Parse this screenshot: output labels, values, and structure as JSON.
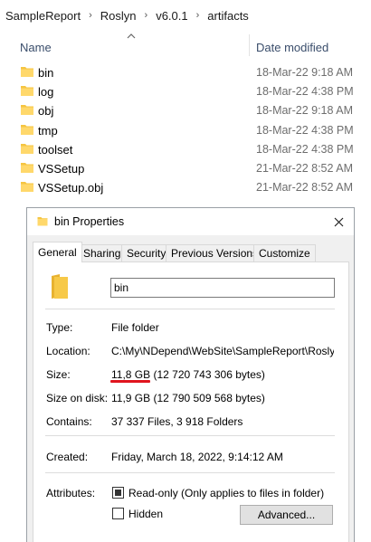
{
  "breadcrumb": [
    "SampleReport",
    "Roslyn",
    "v6.0.1",
    "artifacts"
  ],
  "columns": {
    "name": "Name",
    "date_modified": "Date modified"
  },
  "files": [
    {
      "name": "bin",
      "date": "18-Mar-22 9:18 AM"
    },
    {
      "name": "log",
      "date": "18-Mar-22 4:38 PM"
    },
    {
      "name": "obj",
      "date": "18-Mar-22 9:18 AM"
    },
    {
      "name": "tmp",
      "date": "18-Mar-22 4:38 PM"
    },
    {
      "name": "toolset",
      "date": "18-Mar-22 4:38 PM"
    },
    {
      "name": "VSSetup",
      "date": "21-Mar-22 8:52 AM"
    },
    {
      "name": "VSSetup.obj",
      "date": "21-Mar-22 8:52 AM"
    }
  ],
  "dialog": {
    "title": "bin Properties",
    "tabs": [
      "General",
      "Sharing",
      "Security",
      "Previous Versions",
      "Customize"
    ],
    "active_tab": "General",
    "name_value": "bin",
    "properties": {
      "type_label": "Type:",
      "type_value": "File folder",
      "location_label": "Location:",
      "location_value": "C:\\My\\NDepend\\WebSite\\SampleReport\\Roslyn\\v",
      "size_label": "Size:",
      "size_value": "11,8 GB (12 720 743 306 bytes)",
      "size_on_disk_label": "Size on disk:",
      "size_on_disk_value": "11,9 GB (12 790 509 568 bytes)",
      "contains_label": "Contains:",
      "contains_value": "37 337 Files, 3 918 Folders",
      "created_label": "Created:",
      "created_value": "Friday, March 18, 2022, 9:14:12 AM",
      "attributes_label": "Attributes:"
    },
    "readonly_label": "Read-only (Only applies to files in folder)",
    "readonly_checked": true,
    "hidden_label": "Hidden",
    "hidden_checked": false,
    "advanced_label": "Advanced..."
  },
  "colors": {
    "folder": "#f5c542",
    "header_text": "#3a4d6b",
    "highlight": "#e0141e"
  },
  "icons": [
    "folder-icon",
    "close-icon",
    "sort-up-icon"
  ]
}
